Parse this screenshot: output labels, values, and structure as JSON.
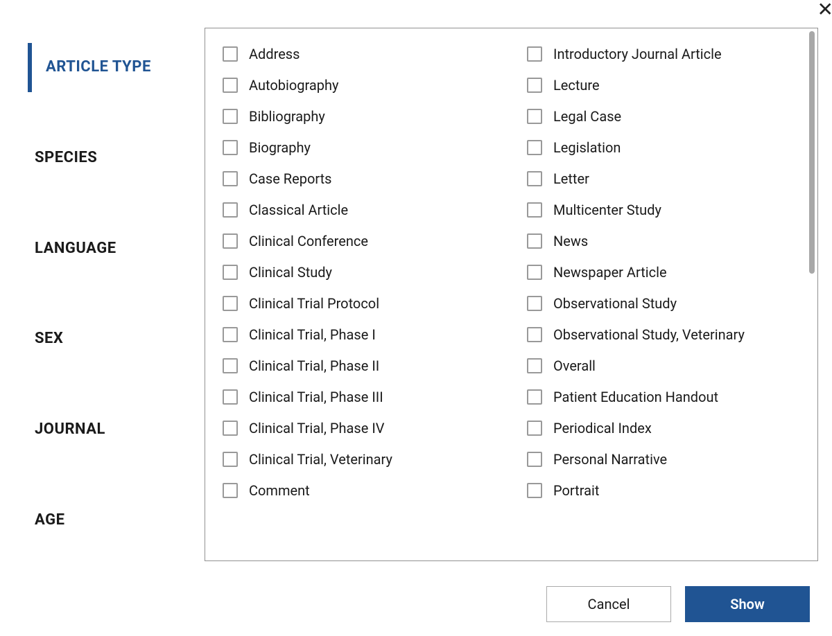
{
  "close_icon": "✕",
  "sidebar": {
    "items": [
      {
        "label": "ARTICLE TYPE",
        "active": true
      },
      {
        "label": "SPECIES",
        "active": false
      },
      {
        "label": "LANGUAGE",
        "active": false
      },
      {
        "label": "SEX",
        "active": false
      },
      {
        "label": "JOURNAL",
        "active": false
      },
      {
        "label": "AGE",
        "active": false
      }
    ]
  },
  "options": {
    "col1": [
      "Address",
      "Autobiography",
      "Bibliography",
      "Biography",
      "Case Reports",
      "Classical Article",
      "Clinical Conference",
      "Clinical Study",
      "Clinical Trial Protocol",
      "Clinical Trial, Phase I",
      "Clinical Trial, Phase II",
      "Clinical Trial, Phase III",
      "Clinical Trial, Phase IV",
      "Clinical Trial, Veterinary",
      "Comment"
    ],
    "col2": [
      "Introductory Journal Article",
      "Lecture",
      "Legal Case",
      "Legislation",
      "Letter",
      "Multicenter Study",
      "News",
      "Newspaper Article",
      "Observational Study",
      "Observational Study, Veterinary",
      "Overall",
      "Patient Education Handout",
      "Periodical Index",
      "Personal Narrative",
      "Portrait"
    ]
  },
  "footer": {
    "cancel_label": "Cancel",
    "show_label": "Show"
  }
}
